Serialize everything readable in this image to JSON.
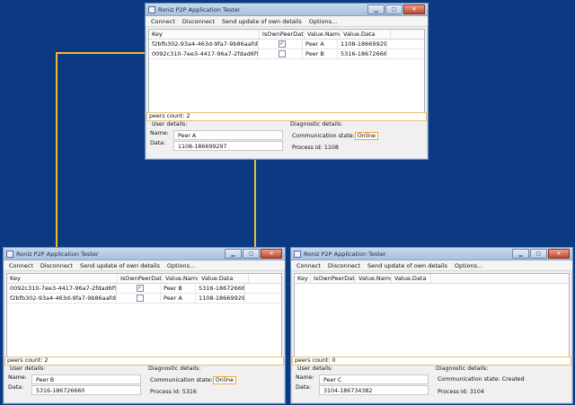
{
  "windows": {
    "top": {
      "title": "Roniz P2P Application Tester",
      "menu": [
        "Connect",
        "Disconnect",
        "Send update of own details",
        "Options..."
      ],
      "headers": [
        "Key",
        "IsOwnPeerData",
        "Value.Name",
        "Value.Data"
      ],
      "rows": [
        {
          "key": "f2bfb302-93a4-463d-9fa7-9b86aafdbf0d",
          "own": true,
          "name": "Peer A",
          "data": "1108-186699297"
        },
        {
          "key": "0092c310-7ee3-4417-96a7-2fdad6f98431",
          "own": false,
          "name": "Peer B",
          "data": "5316-186726660"
        }
      ],
      "peers_count": "peers count: 2",
      "user_details_label": "User details:",
      "name_label": "Name:",
      "data_label": "Data:",
      "user_name": "Peer A",
      "user_data": "1108-186699297",
      "diag_label": "Diagnostic details:",
      "comm_label": "Communication state:",
      "comm_state": "Online",
      "process_id": "Process Id: 1108"
    },
    "left": {
      "title": "Roniz P2P Application Tester",
      "menu": [
        "Connect",
        "Disconnect",
        "Send update of own details",
        "Options..."
      ],
      "headers": [
        "Key",
        "IsOwnPeerData",
        "Value.Name",
        "Value.Data"
      ],
      "rows": [
        {
          "key": "0092c310-7ee3-4417-96a7-2fdad6f98431",
          "own": true,
          "name": "Peer B",
          "data": "5316-186726660"
        },
        {
          "key": "f2bfb302-93a4-463d-9fa7-9b86aafdbf0d",
          "own": false,
          "name": "Peer A",
          "data": "1108-186699297"
        }
      ],
      "peers_count": "peers count: 2",
      "user_details_label": "User details:",
      "name_label": "Name:",
      "data_label": "Data:",
      "user_name": "Peer B",
      "user_data": "5316-186726660",
      "diag_label": "Diagnostic details:",
      "comm_label": "Communication state:",
      "comm_state": "Online",
      "process_id": "Process Id: 5316"
    },
    "right": {
      "title": "Roniz P2P Application Tester",
      "menu": [
        "Connect",
        "Disconnect",
        "Send update of own details",
        "Options..."
      ],
      "headers": [
        "Key",
        "IsOwnPeerData",
        "Value.Name",
        "Value.Data"
      ],
      "rows": [],
      "peers_count": "peers count: 0",
      "user_details_label": "User details:",
      "name_label": "Name:",
      "data_label": "Data:",
      "user_name": "Peer C",
      "user_data": "3104-186734382",
      "diag_label": "Diagnostic details:",
      "comm_label": "Communication state:",
      "comm_state": "Created",
      "process_id": "Process Id: 3104"
    }
  },
  "icons": {
    "minimize": "minimize-icon",
    "maximize": "maximize-icon",
    "close": "close-icon"
  },
  "colors": {
    "desktop": "#0b3a82",
    "highlight": "#f3b731"
  }
}
